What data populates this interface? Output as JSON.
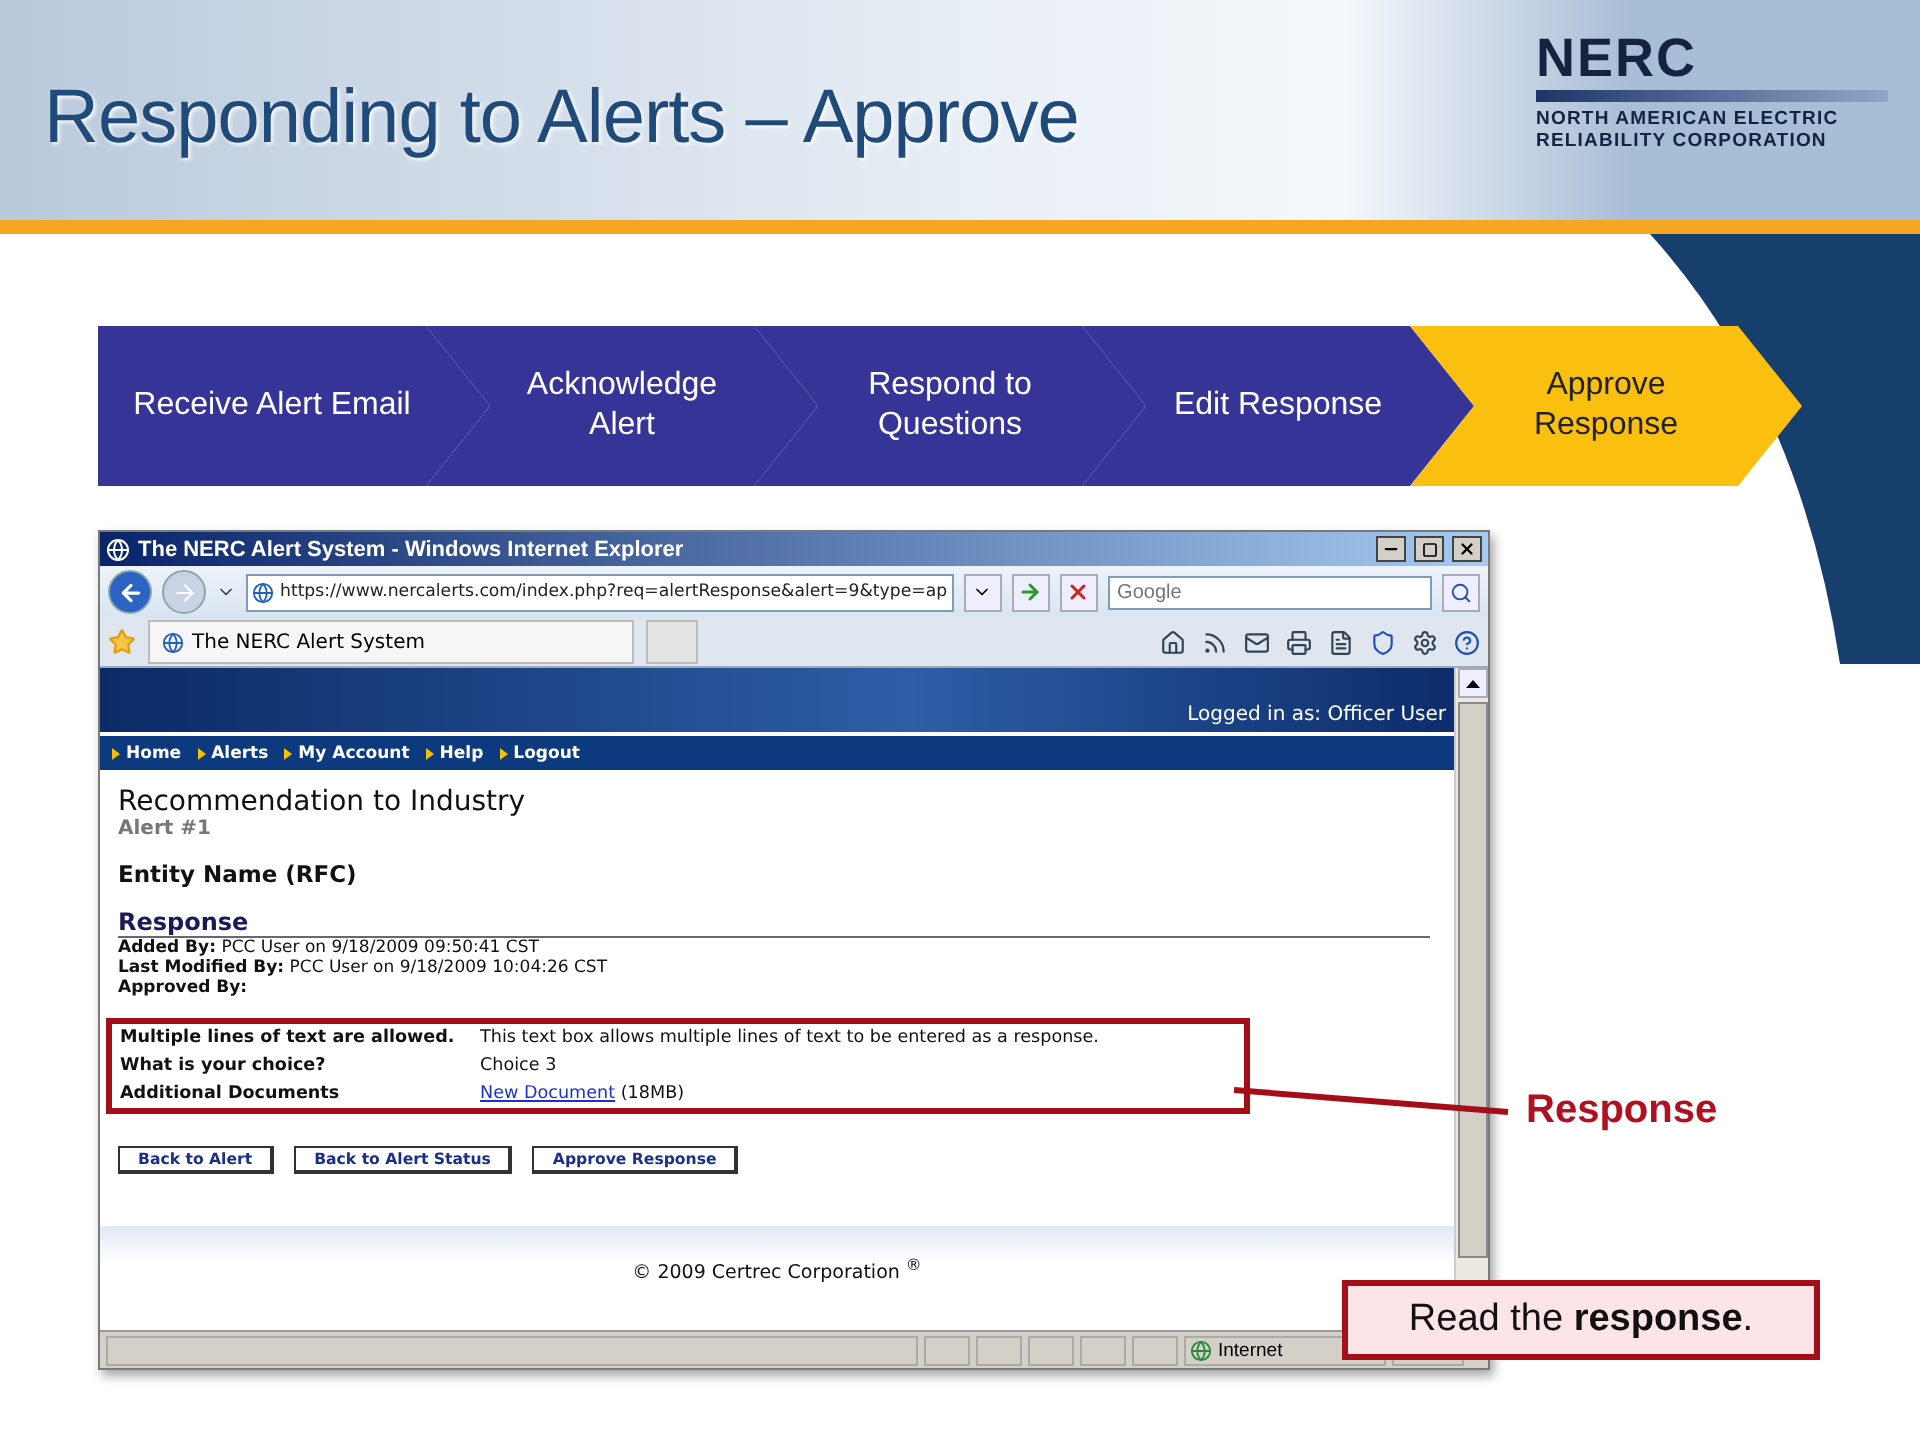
{
  "title": "Responding to Alerts – Approve",
  "logo": {
    "name": "NERC",
    "lines": [
      "NORTH AMERICAN ELECTRIC",
      "RELIABILITY CORPORATION"
    ]
  },
  "steps": [
    {
      "label": "Receive Alert Email",
      "selected": false
    },
    {
      "label": "Acknowledge Alert",
      "selected": false
    },
    {
      "label": "Respond to Questions",
      "selected": false
    },
    {
      "label": "Edit Response",
      "selected": false
    },
    {
      "label": "Approve Response",
      "selected": true
    }
  ],
  "browser": {
    "title": "The NERC Alert System - Windows Internet Explorer",
    "address": "https://www.nercalerts.com/index.php?req=alertResponse&alert=9&type=ap",
    "search": {
      "placeholder": "Google"
    },
    "tab_title": "The NERC Alert System",
    "status_zone": "Internet"
  },
  "page": {
    "logged_in": "Logged in as: Officer User",
    "nav": [
      "Home",
      "Alerts",
      "My Account",
      "Help",
      "Logout"
    ],
    "heading": "Recommendation to Industry",
    "subheading": "Alert #1",
    "entity": "Entity Name (RFC)",
    "section": "Response",
    "meta": [
      {
        "label": "Added By:",
        "value": "PCC User on 9/18/2009 09:50:41 CST"
      },
      {
        "label": "Last Modified By:",
        "value": "PCC User on 9/18/2009 10:04:26 CST"
      },
      {
        "label": "Approved By:"
      }
    ],
    "answers": [
      {
        "question": "Multiple lines of text are allowed.",
        "value": "This text box allows multiple lines of text to be entered as a response."
      },
      {
        "question": "What is your choice?",
        "value": "Choice 3"
      },
      {
        "question": "Additional Documents",
        "link": "New Document",
        "value": "(18MB)"
      }
    ],
    "buttons": [
      "Back to Alert",
      "Back to Alert Status",
      "Approve Response"
    ],
    "footer": "© 2009 Certrec Corporation $^{®}$"
  },
  "callout": "Response",
  "note": "Read the **response**."
}
